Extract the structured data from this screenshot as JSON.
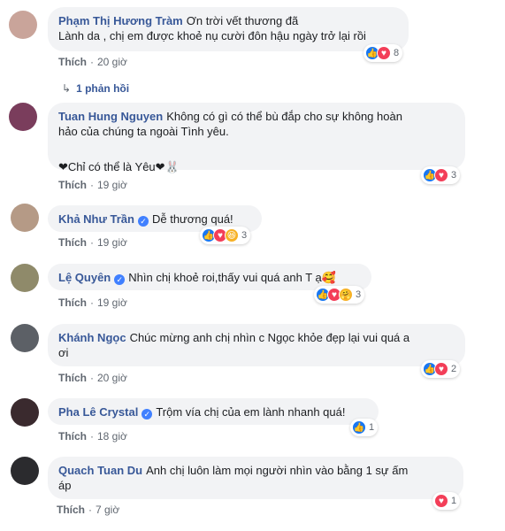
{
  "comments": [
    {
      "author": "Phạm Thị Hương Tràm",
      "verified": false,
      "text_lines": [
        "Ơn trời vết thương đã",
        "Lành da , chị em được khoẻ nụ cười đôn hậu ngày trở lại rồi"
      ],
      "like_label": "Thích",
      "time": "20 giờ",
      "reactions": [
        "like",
        "love"
      ],
      "reaction_count": "8",
      "reply_label": "1 phản hồi",
      "avatar_color": "#c9a49a"
    },
    {
      "author": "Tuan Hung Nguyen",
      "verified": false,
      "text_lines": [
        "Không có gì có thể bù đắp cho sự không hoàn",
        "hảo của chúng ta ngoài Tình yêu.",
        "",
        "❤Chỉ có thể là Yêu❤🐰"
      ],
      "like_label": "Thích",
      "time": "19 giờ",
      "reactions": [
        "like",
        "love"
      ],
      "reaction_count": "3",
      "avatar_color": "#7a3d5c"
    },
    {
      "author": "Khả Như Trần",
      "verified": true,
      "text_lines": [
        "Dễ thương quá!"
      ],
      "like_label": "Thích",
      "time": "19 giờ",
      "reactions": [
        "like",
        "love",
        "haha"
      ],
      "reaction_count": "3",
      "avatar_color": "#b59a86"
    },
    {
      "author": "Lệ Quyên",
      "verified": true,
      "text_lines": [
        "Nhìn chị khoẻ roi,thấy vui quá anh T ạ🥰"
      ],
      "like_label": "Thích",
      "time": "19 giờ",
      "reactions": [
        "like",
        "love",
        "care"
      ],
      "reaction_count": "3",
      "avatar_color": "#8f8a6a"
    },
    {
      "author": "Khánh Ngọc",
      "verified": false,
      "text_lines": [
        "Chúc mừng anh chị nhìn c Ngọc khỏe đẹp lại vui quá a",
        "ơi"
      ],
      "like_label": "Thích",
      "time": "20 giờ",
      "reactions": [
        "like",
        "love"
      ],
      "reaction_count": "2",
      "avatar_color": "#5c6066"
    },
    {
      "author": "Pha Lê Crystal",
      "verified": true,
      "text_lines": [
        "Trộm vía chị của em lành nhanh quá!"
      ],
      "like_label": "Thích",
      "time": "18 giờ",
      "reactions": [
        "like"
      ],
      "reaction_count": "1",
      "avatar_color": "#3a2a2e"
    },
    {
      "author": "Quach Tuan Du",
      "verified": false,
      "text_lines": [
        "Anh chị luôn làm mọi người nhìn vào bằng 1 sự ấm",
        "áp"
      ],
      "like_label": "Thích",
      "time": "7 giờ",
      "reactions": [
        "love"
      ],
      "reaction_count": "1",
      "avatar_color": "#2b2b2e"
    }
  ]
}
